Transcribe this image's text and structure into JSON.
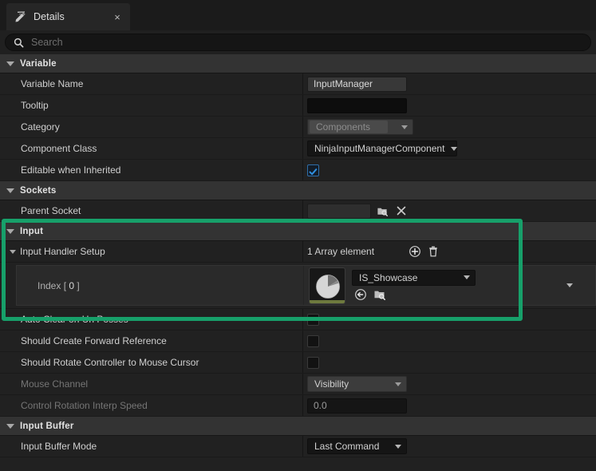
{
  "tab": {
    "label": "Details",
    "icon": "details-pencil-icon",
    "close_label": "×"
  },
  "search": {
    "placeholder": "Search",
    "value": "",
    "icon": "search-icon"
  },
  "colors": {
    "highlight": "#17a06a",
    "checkbox_checked": "#2f8fe0",
    "asset_type_strip": "#6e7a3e"
  },
  "sections": {
    "variable": {
      "title": "Variable",
      "rows": [
        {
          "label": "Variable Name",
          "value": "InputManager"
        },
        {
          "label": "Tooltip",
          "value": ""
        },
        {
          "label": "Category",
          "value": "Components"
        },
        {
          "label": "Component Class",
          "value": "NinjaInputManagerComponent"
        },
        {
          "label": "Editable when Inherited",
          "value": "checked"
        }
      ]
    },
    "sockets": {
      "title": "Sockets",
      "rows": [
        {
          "label": "Parent Socket",
          "value": ""
        }
      ]
    },
    "input": {
      "title": "Input",
      "handler_setup": {
        "label": "Input Handler Setup",
        "count_text": "1 Array element",
        "add_icon": "add-element-icon",
        "delete_icon": "delete-elements-icon"
      },
      "element": {
        "index_prefix": "Index",
        "index_value": "0",
        "asset_name": "IS_Showcase",
        "use_selected_icon": "use-selected-asset-icon",
        "browse_icon": "browse-to-asset-icon",
        "expander_icon": "chevron-down-icon"
      },
      "rows": [
        {
          "label": "Auto Clear on Un Posses",
          "value": "unchecked"
        },
        {
          "label": "Should Create Forward Reference",
          "value": "unchecked"
        },
        {
          "label": "Should Rotate Controller to Mouse Cursor",
          "value": "unchecked"
        },
        {
          "label": "Mouse Channel",
          "value": "Visibility",
          "disabled": true
        },
        {
          "label": "Control Rotation Interp Speed",
          "value": "0.0",
          "disabled": true
        }
      ]
    },
    "input_buffer": {
      "title": "Input Buffer",
      "rows": [
        {
          "label": "Input Buffer Mode",
          "value": "Last Command"
        }
      ]
    }
  }
}
